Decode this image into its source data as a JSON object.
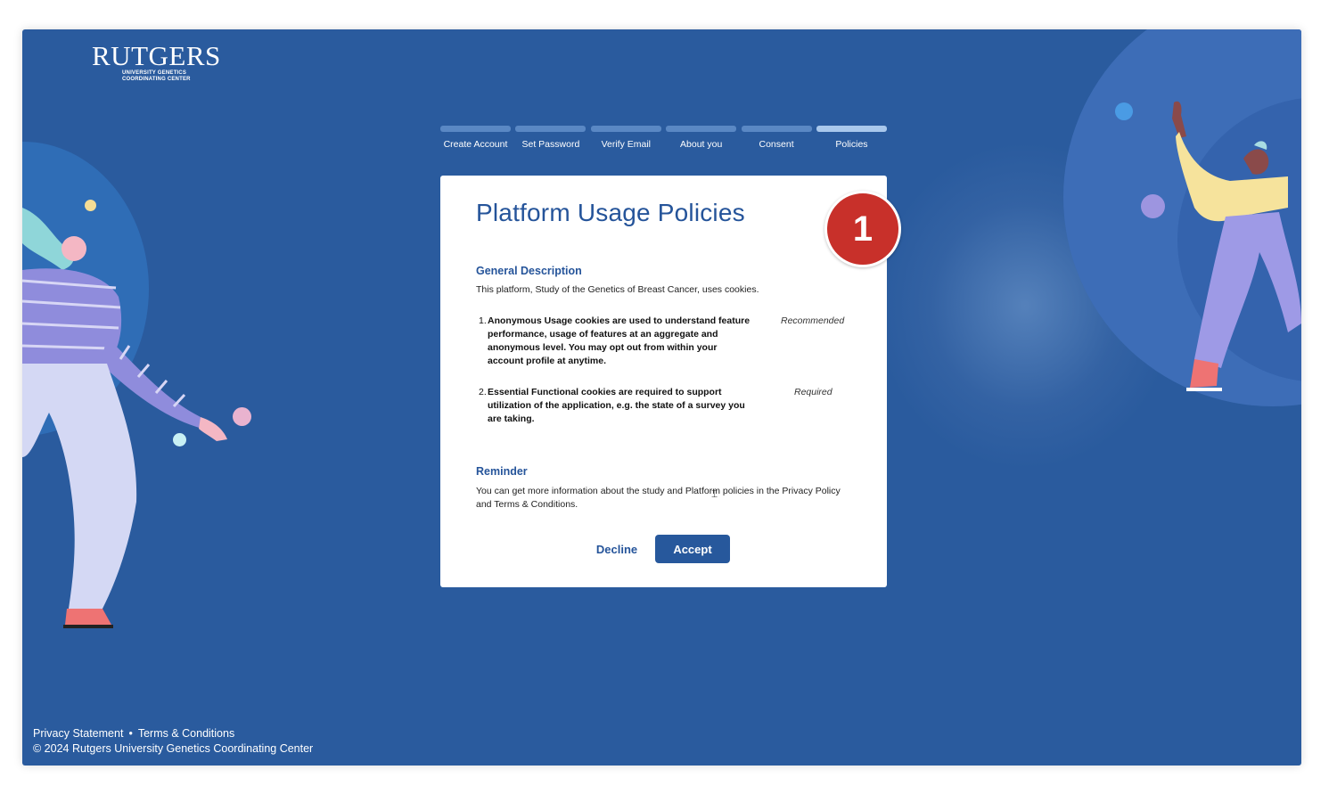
{
  "logo": {
    "word": "RUTGERS",
    "line1": "UNIVERSITY GENETICS",
    "line2": "COORDINATING CENTER"
  },
  "steps": [
    {
      "label": "Create Account",
      "state": "done"
    },
    {
      "label": "Set Password",
      "state": "done"
    },
    {
      "label": "Verify Email",
      "state": "done"
    },
    {
      "label": "About you",
      "state": "done"
    },
    {
      "label": "Consent",
      "state": "done"
    },
    {
      "label": "Policies",
      "state": "current"
    }
  ],
  "card": {
    "title": "Platform Usage Policies",
    "badge": "1",
    "general_heading": "General Description",
    "general_text": "This platform, Study of the Genetics of Breast Cancer, uses cookies.",
    "policies": [
      {
        "number": "1.",
        "text": "Anonymous Usage cookies are used to understand feature performance, usage of features at an aggregate and anonymous level. You may opt out from within your account profile at anytime.",
        "tag": "Recommended"
      },
      {
        "number": "2.",
        "text": "Essential Functional cookies are required to support utilization of the application, e.g. the state of a survey you are taking.",
        "tag": "Required"
      }
    ],
    "reminder_heading": "Reminder",
    "reminder_text": "You can get more information about the study and Platform policies in the Privacy Policy and Terms & Conditions.",
    "decline_label": "Decline",
    "accept_label": "Accept"
  },
  "footer": {
    "privacy_label": "Privacy Statement",
    "separator": "•",
    "terms_label": "Terms & Conditions",
    "copyright": "© 2024 Rutgers University Genetics Coordinating Center"
  },
  "colors": {
    "background": "#2a5b9e",
    "brand_blue": "#25549a",
    "accept_button": "#27589c",
    "badge_red": "#c8302a",
    "step_inactive": "#5a88c4",
    "step_active": "#a9c8ec"
  },
  "icons": [
    "text-cursor-icon"
  ]
}
